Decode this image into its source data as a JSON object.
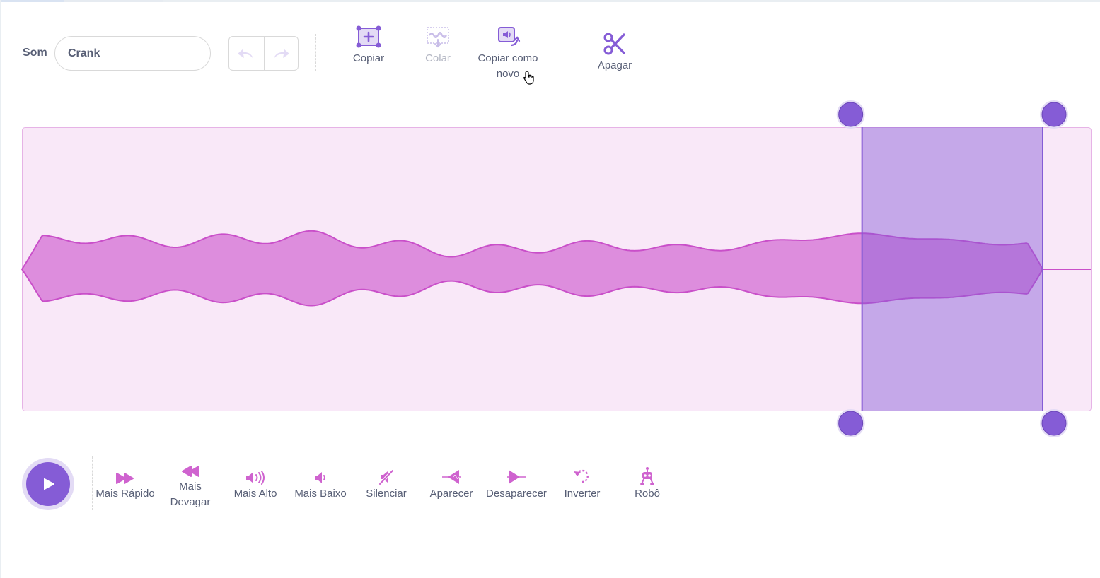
{
  "toolbar": {
    "sound_label": "Som",
    "sound_name": "Crank",
    "undo_label": "undo",
    "redo_label": "redo",
    "copy_label": "Copiar",
    "paste_label": "Colar",
    "copy_new_line1": "Copiar como",
    "copy_new_line2": "novo",
    "delete_label": "Apagar"
  },
  "effects": [
    {
      "label": "Mais Rápido",
      "icon": "faster-icon"
    },
    {
      "label": "Mais Devagar",
      "icon": "slower-icon"
    },
    {
      "label": "Mais Alto",
      "icon": "louder-icon"
    },
    {
      "label": "Mais Baixo",
      "icon": "softer-icon"
    },
    {
      "label": "Silenciar",
      "icon": "mute-icon"
    },
    {
      "label": "Aparecer",
      "icon": "fade-in-icon"
    },
    {
      "label": "Desaparecer",
      "icon": "fade-out-icon"
    },
    {
      "label": "Inverter",
      "icon": "reverse-icon"
    },
    {
      "label": "Robô",
      "icon": "robot-icon"
    }
  ],
  "waveform": {
    "selection_start": 0.786,
    "selection_end": 0.955
  },
  "colors": {
    "accent": "#855cd6",
    "sound_pink": "#cf63cf",
    "wave_fill": "#dd8ddd",
    "wave_bg": "#f9e8f8",
    "selection": "#bfa0e6"
  }
}
